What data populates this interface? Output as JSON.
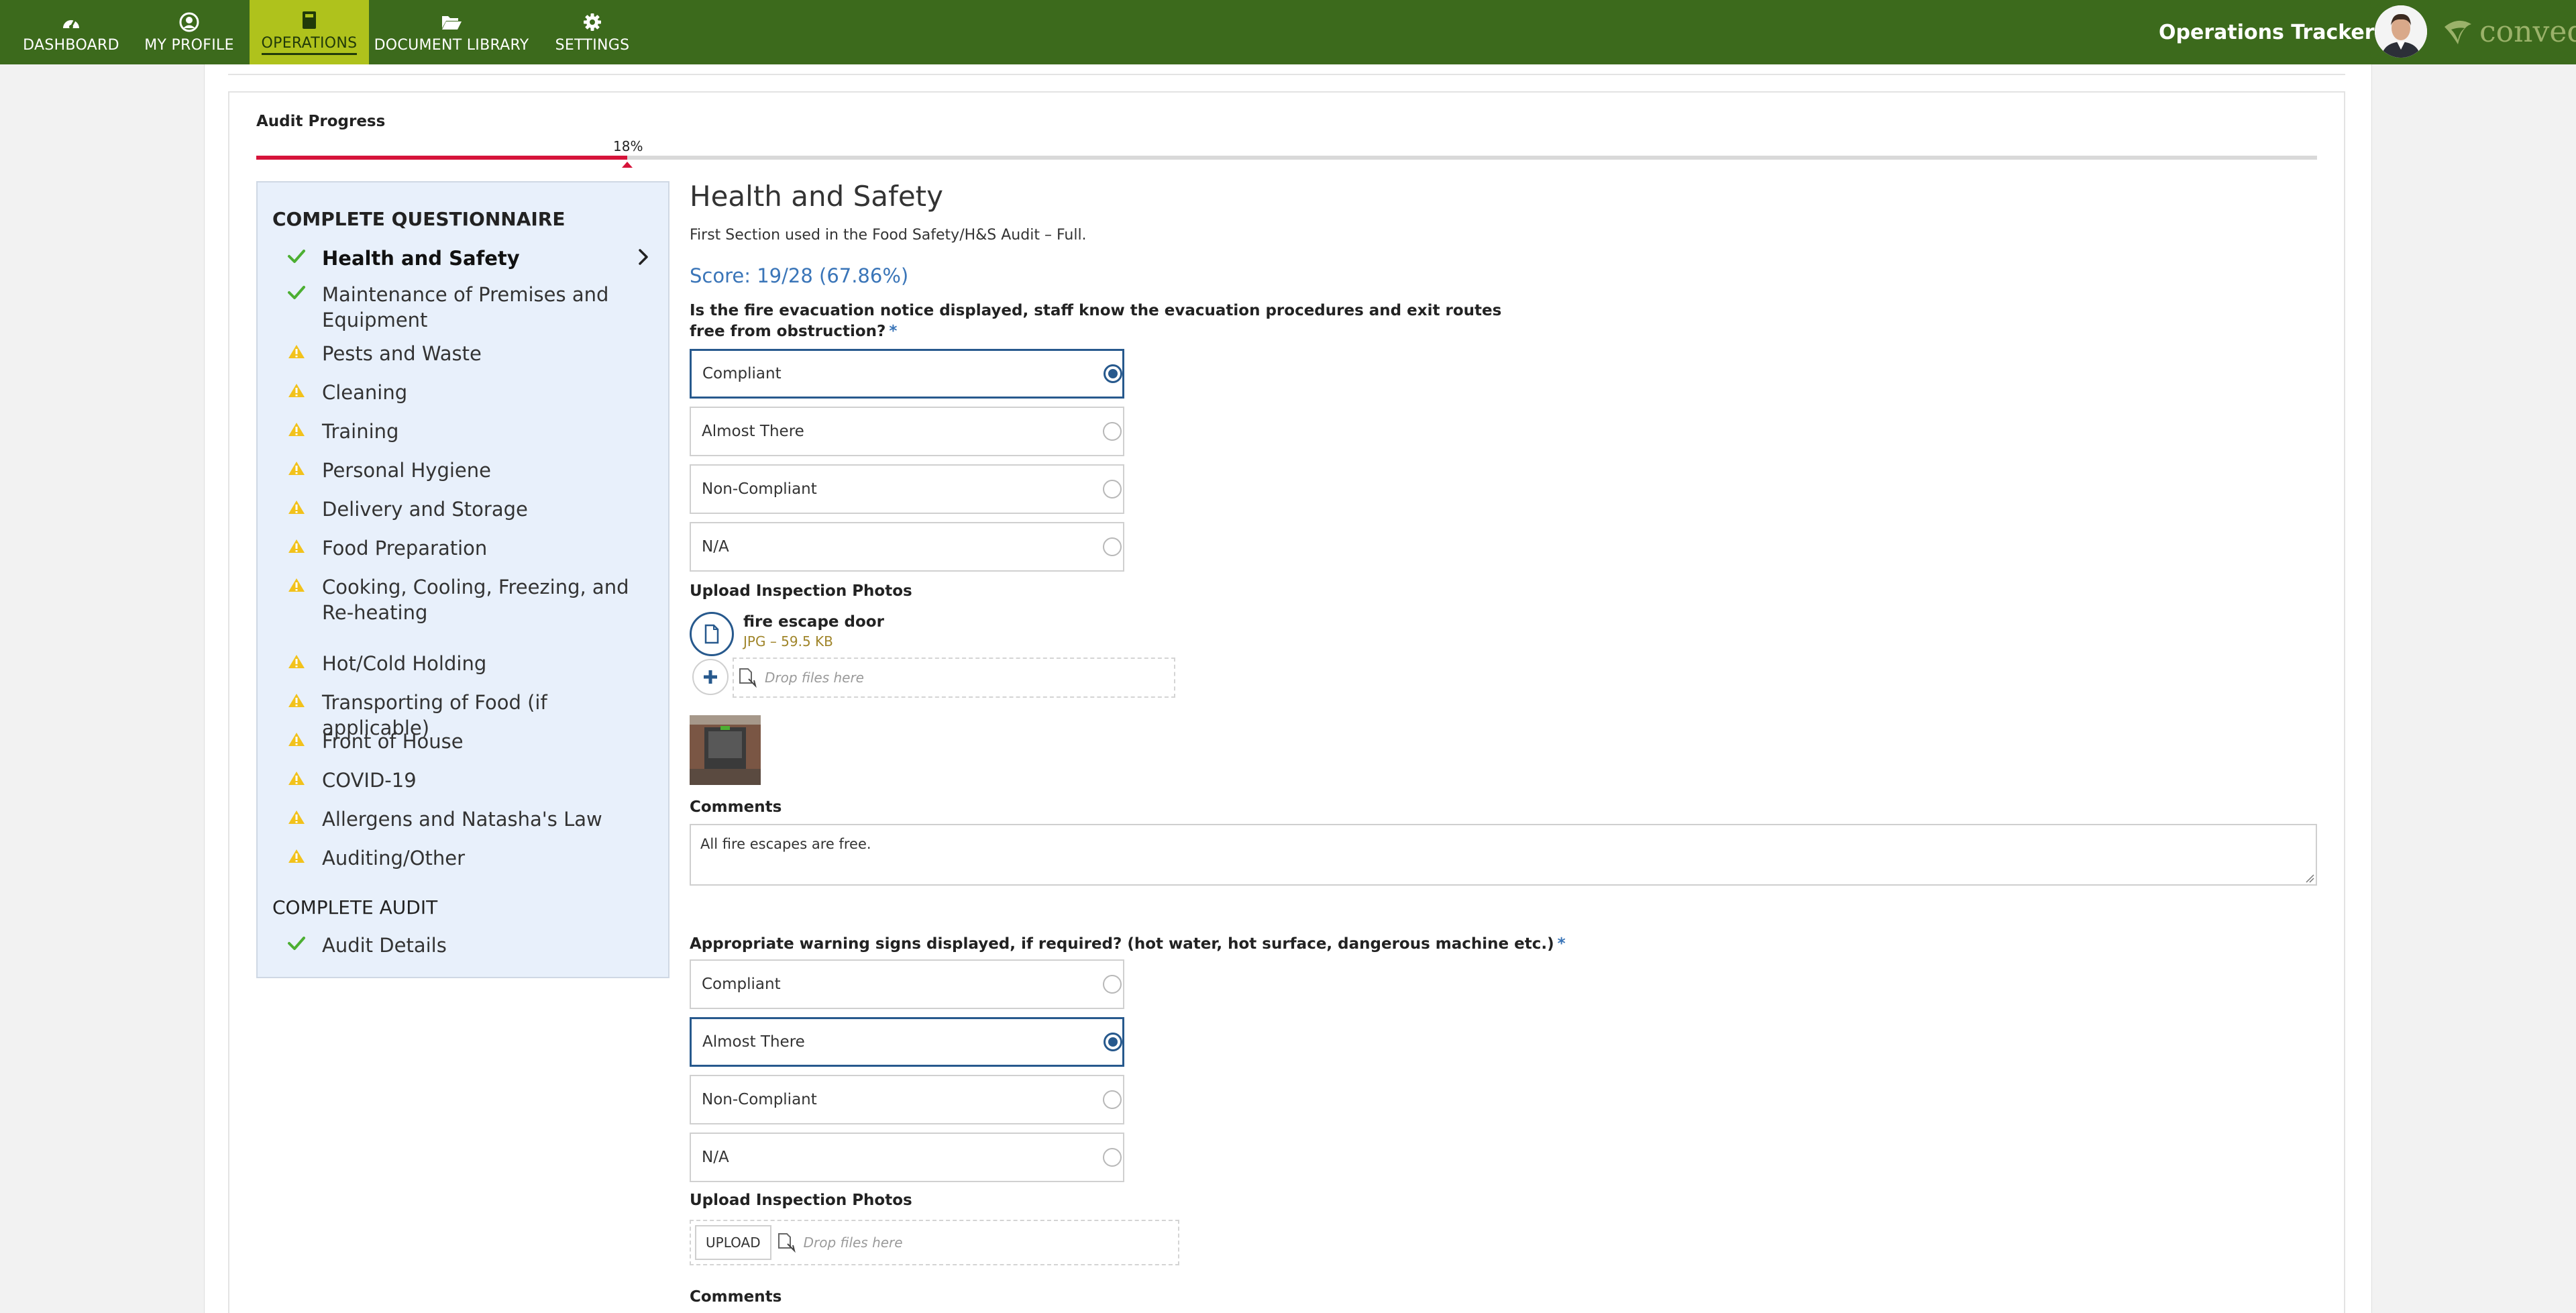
{
  "nav": {
    "items": [
      {
        "label": "DASHBOARD",
        "icon": "dashboard-gauge-icon"
      },
      {
        "label": "MY PROFILE",
        "icon": "user-circle-icon"
      },
      {
        "label": "OPERATIONS",
        "icon": "book-icon"
      },
      {
        "label": "DOCUMENT LIBRARY",
        "icon": "folder-open-icon"
      },
      {
        "label": "SETTINGS",
        "icon": "gear-icon"
      }
    ],
    "active": "OPERATIONS",
    "app_menu_label": "Operations Tracker",
    "logo_text": "convedo"
  },
  "progress": {
    "title": "Audit Progress",
    "percent_label": "18%",
    "fraction": 0.18
  },
  "sidebar": {
    "heading": "COMPLETE QUESTIONNAIRE",
    "items": [
      {
        "label": "Health and Safety",
        "status": "complete",
        "current": true
      },
      {
        "label": "Maintenance of Premises and Equipment",
        "status": "complete"
      },
      {
        "label": "Pests and Waste",
        "status": "warning"
      },
      {
        "label": "Cleaning",
        "status": "warning"
      },
      {
        "label": "Training",
        "status": "warning"
      },
      {
        "label": "Personal Hygiene",
        "status": "warning"
      },
      {
        "label": "Delivery and Storage",
        "status": "warning"
      },
      {
        "label": "Food Preparation",
        "status": "warning"
      },
      {
        "label": "Cooking, Cooling, Freezing, and Re-heating",
        "status": "warning"
      },
      {
        "label": "Hot/Cold Holding",
        "status": "warning"
      },
      {
        "label": "Transporting of Food (if applicable)",
        "status": "warning"
      },
      {
        "label": "Front of House",
        "status": "warning"
      },
      {
        "label": "COVID-19",
        "status": "warning"
      },
      {
        "label": "Allergens and Natasha's Law",
        "status": "warning"
      },
      {
        "label": "Auditing/Other",
        "status": "warning"
      }
    ],
    "audit_heading": "COMPLETE AUDIT",
    "audit_items": [
      {
        "label": "Audit Details",
        "status": "complete"
      }
    ]
  },
  "section": {
    "title": "Health and Safety",
    "description": "First Section used in the Food Safety/H&S Audit – Full.",
    "score": "Score: 19/28 (67.86%)"
  },
  "questions": [
    {
      "label": "Is the fire evacuation notice displayed, staff know the evacuation procedures and exit routes free from obstruction?",
      "required_mark": "*",
      "options": [
        "Compliant",
        "Almost There",
        "Non-Compliant",
        "N/A"
      ],
      "selected": "Compliant",
      "upload_label": "Upload Inspection Photos",
      "file": {
        "name": "fire escape door",
        "meta": "JPG – 59.5 KB"
      },
      "drop_text": "Drop files here",
      "comments_label": "Comments",
      "comment": "All fire escapes are free."
    },
    {
      "label": "Appropriate warning signs displayed, if required? (hot water, hot surface, dangerous machine etc.)",
      "required_mark": "*",
      "options": [
        "Compliant",
        "Almost There",
        "Non-Compliant",
        "N/A"
      ],
      "selected": "Almost There",
      "upload_label": "Upload Inspection Photos",
      "upload_button": "UPLOAD",
      "drop_text": "Drop files here",
      "comments_label": "Comments"
    }
  ],
  "colors": {
    "nav_bg": "#3c6a1c",
    "nav_active": "#afc21c",
    "progress_fill": "#d6143a",
    "accent_blue": "#3a75b8",
    "check_green": "#4caf32",
    "warning_yellow": "#f2c21b"
  }
}
